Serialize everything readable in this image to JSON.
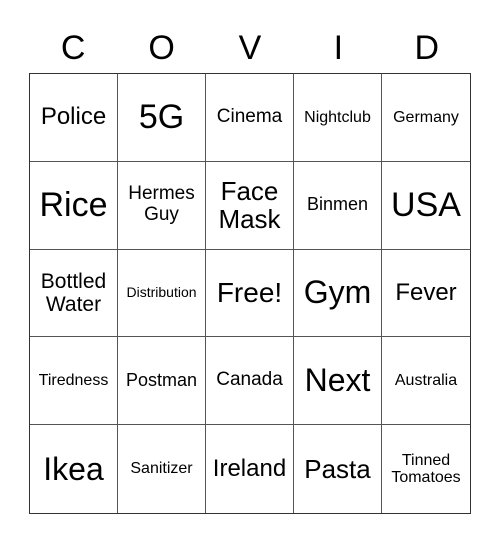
{
  "title_letters": [
    "C",
    "O",
    "V",
    "I",
    "D"
  ],
  "board": [
    [
      "Police",
      "5G",
      "Cinema",
      "Nightclub",
      "Germany"
    ],
    [
      "Rice",
      "Hermes Guy",
      "Face Mask",
      "Binmen",
      "USA"
    ],
    [
      "Bottled Water",
      "Distribution",
      "Free!",
      "Gym",
      "Fever"
    ],
    [
      "Tiredness",
      "Postman",
      "Canada",
      "Next",
      "Australia"
    ],
    [
      "Ikea",
      "Sanitizer",
      "Ireland",
      "Pasta",
      "Tinned Tomatoes"
    ]
  ],
  "free_space": {
    "row": 2,
    "col": 2,
    "label": "Free!"
  }
}
